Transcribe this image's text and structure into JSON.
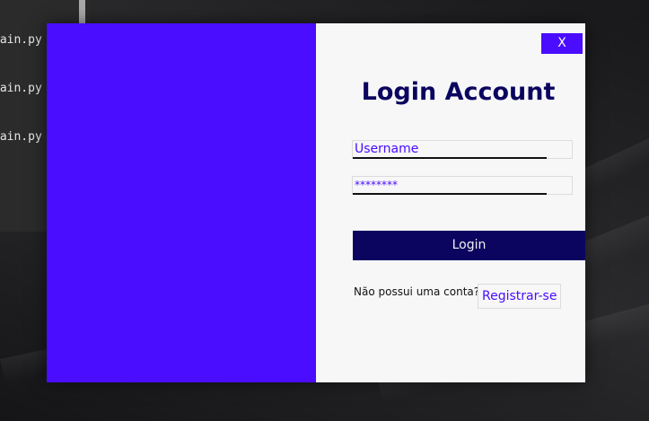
{
  "colors": {
    "accent": "#4a0dff",
    "title": "#0b0560",
    "login_button_bg": "#0b0560",
    "panel_bg": "#f7f7f7",
    "input_text": "#4a0dff"
  },
  "terminal": {
    "lines": [
      "main.py",
      "main.py",
      "main.py"
    ]
  },
  "login": {
    "close_label": "X",
    "title": "Login Account",
    "username_value": "Username",
    "password_value": "********",
    "login_label": "Login",
    "no_account_text": "Não possui uma conta?",
    "register_label": "Registrar-se"
  }
}
